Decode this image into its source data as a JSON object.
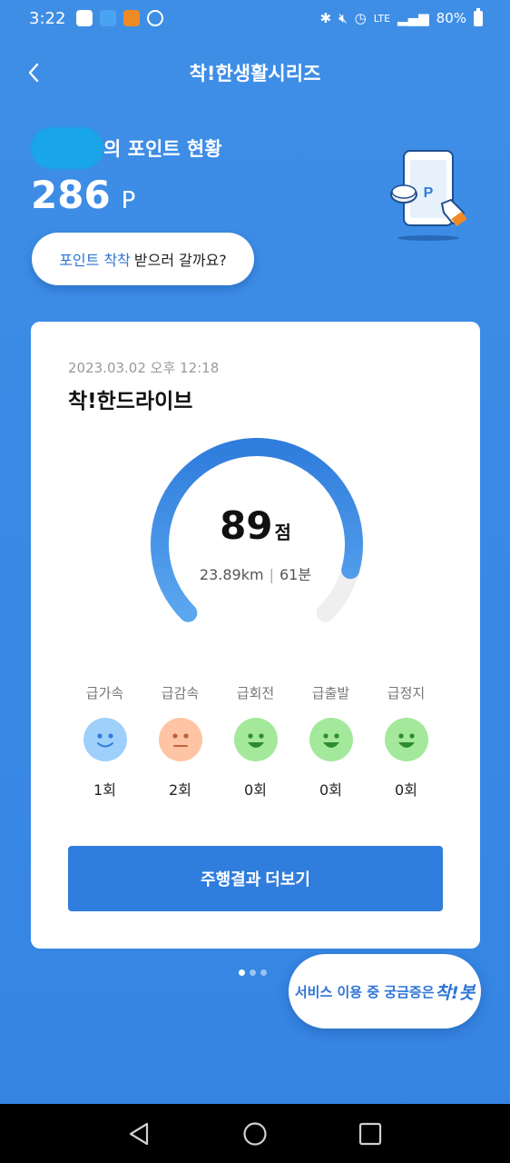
{
  "status_bar": {
    "time": "3:22",
    "network": "LTE",
    "battery": "80%"
  },
  "header": {
    "title": "착!한생활시리즈"
  },
  "points": {
    "owner_suffix": "의 포인트 현황",
    "value": "286",
    "unit": "P"
  },
  "bubble": {
    "highlight": "포인트 착착",
    "text": "받으러 갈까요?"
  },
  "illustration": {
    "icon": "phone-point-icon",
    "label": "P"
  },
  "card": {
    "date": "2023.03.02 오후 12:18",
    "title": "착!한드라이브",
    "score": "89",
    "score_unit": "점",
    "score_fraction": 0.89,
    "distance": "23.89km",
    "duration": "61분",
    "events": [
      {
        "label": "급가속",
        "count": "1회",
        "face": "smile",
        "color": "#9fd0fb"
      },
      {
        "label": "급감속",
        "count": "2회",
        "face": "neutral",
        "color": "#ffc4a3"
      },
      {
        "label": "급회전",
        "count": "0회",
        "face": "happy",
        "color": "#a3e89b"
      },
      {
        "label": "급출발",
        "count": "0회",
        "face": "happy",
        "color": "#a3e89b"
      },
      {
        "label": "급정지",
        "count": "0회",
        "face": "happy",
        "color": "#a3e89b"
      }
    ],
    "more_button": "주행결과 더보기"
  },
  "pager": {
    "total": 3,
    "active": 0
  },
  "chatbot": {
    "text": "서비스 이용 중 궁금증은",
    "brand": "착!봇"
  },
  "colors": {
    "background": "#3a8ae5",
    "accent": "#2f7ddc",
    "gauge_start": "#2f7ddc",
    "gauge_end": "#5aa6ef"
  }
}
